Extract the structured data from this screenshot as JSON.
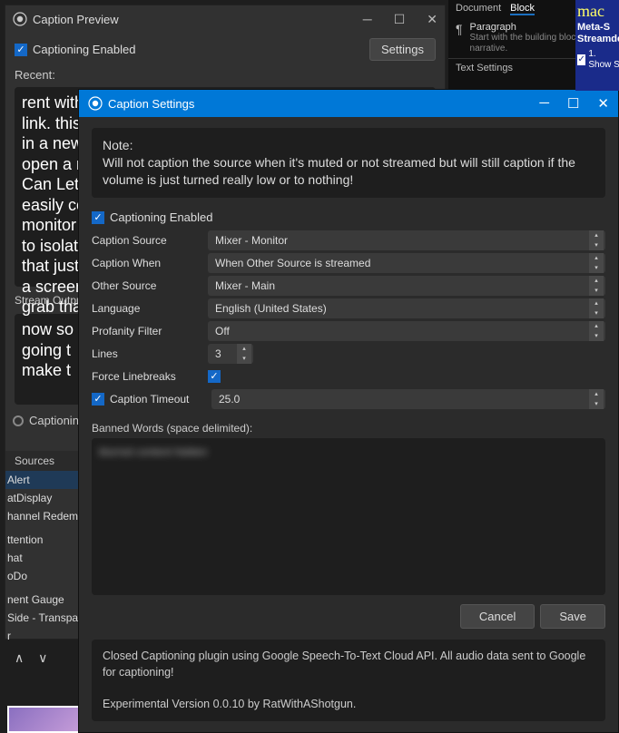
{
  "preview": {
    "title": "Caption Preview",
    "captioning_enabled_label": "Captioning Enabled",
    "settings_btn": "Settings",
    "recent_label": "Recent:",
    "recent_text": "rent with\nlink.  this\nin a new\nopen a n\nCan Let\neasily co\nmonitor\nto isolate\nthat just\na screen\ngrab tha",
    "stream_output_label": "Stream Output",
    "stream_text": "now so\ngoing t\nmake t",
    "status": "Captioning",
    "sources_header": "Sources",
    "sources": [
      "Alert",
      "atDisplay",
      "hannel Redemptio",
      "",
      "ttention",
      "hat",
      "oDo",
      "",
      "nent Gauge",
      "Side - Transparen",
      "r"
    ],
    "selected_source_index": 0
  },
  "right_panel": {
    "tabs": [
      "Document",
      "Block"
    ],
    "active_tab_index": 1,
    "para_label": "Paragraph",
    "para_desc": "Start with the building block of all narrative.",
    "text_settings": "Text Settings",
    "ad_logo": "mac",
    "ad_line1": "Meta-S",
    "ad_line2": "Streamde",
    "ad_check": "1. Show S"
  },
  "dialog": {
    "title": "Caption Settings",
    "note_h": "Note:",
    "note_body": "Will not caption the source when it's muted or not streamed but will still caption if the volume is just turned really low or to nothing!",
    "captioning_enabled_label": "Captioning Enabled",
    "rows": {
      "caption_source": {
        "label": "Caption Source",
        "value": "Mixer - Monitor"
      },
      "caption_when": {
        "label": "Caption When",
        "value": "When Other Source is streamed"
      },
      "other_source": {
        "label": "Other Source",
        "value": "Mixer - Main"
      },
      "language": {
        "label": "Language",
        "value": "English (United States)"
      },
      "profanity": {
        "label": "Profanity Filter",
        "value": "Off"
      },
      "lines": {
        "label": "Lines",
        "value": "3"
      },
      "force_lb": {
        "label": "Force Linebreaks"
      },
      "timeout": {
        "label": "Caption Timeout",
        "value": "25.0"
      }
    },
    "banned_label": "Banned Words (space delimited):",
    "banned_blur": "blurred content hidden",
    "cancel": "Cancel",
    "save": "Save",
    "footer1": "Closed Captioning plugin using Google Speech-To-Text Cloud API. All audio data sent to Google for captioning!",
    "footer2": "Experimental Version 0.0.10 by RatWithAShotgun."
  }
}
